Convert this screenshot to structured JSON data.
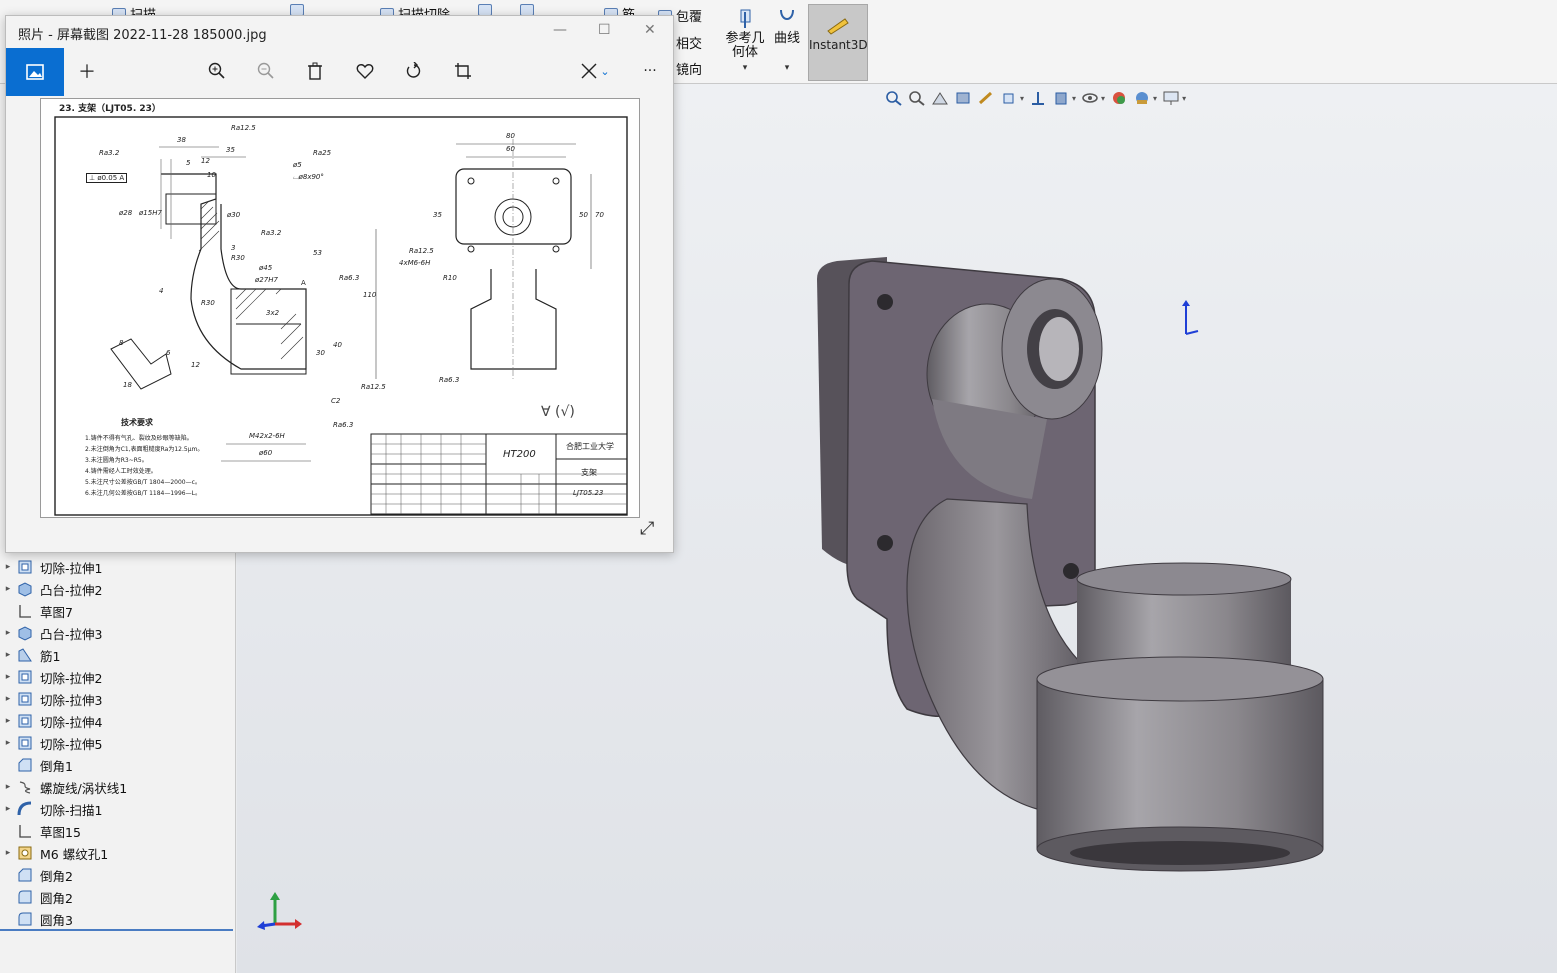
{
  "ribbon": {
    "sweep": "扫描",
    "sweep_cut": "扫描切除",
    "wrap": "包覆",
    "intersect": "相交",
    "mirror": "镜向",
    "ref_geometry_l1": "参考几",
    "ref_geometry_l2": "何体",
    "curves": "曲线",
    "instant3d": "Instant3D",
    "rib": "筋"
  },
  "photo_viewer": {
    "title": "照片 - 屏幕截图 2022-11-28 185000.jpg",
    "minimize": "—",
    "maximize": "☐",
    "close": "✕",
    "more": "···"
  },
  "drawing": {
    "heading": "23. 支架（LJT05. 23）",
    "material": "HT200",
    "school": "合肥工业大学",
    "part_name": "支架",
    "drawing_no": "LJT05.23",
    "tech_title": "技术要求",
    "tech_reqs": [
      "1.铸件不得有气孔、裂纹及砂眼等缺陷。",
      "2.未注倒角为C1,表面粗糙度Ra为12.5μm。",
      "3.未注圆角为R3~R5。",
      "4.铸件需经人工时效处理。",
      "5.未注尺寸公差按GB/T 1804—2000—c。",
      "6.未注几何公差按GB/T 1184—1996—L。"
    ],
    "dims": {
      "d38": "38",
      "d35": "35",
      "d5": "5",
      "d12": "12",
      "d10": "10",
      "ra125a": "Ra12.5",
      "ra32a": "Ra3.2",
      "ra25": "Ra25",
      "phi5": "ø5",
      "phi8": "⌴ø8x90°",
      "tol": "⊥ ø0.05 A",
      "phi28": "ø28",
      "phi15h7": "ø15H7",
      "phi30": "ø30",
      "r30": "R30",
      "r30b": "R30",
      "phi45": "ø45",
      "phi27h7": "ø27H7",
      "ra63a": "Ra6.3",
      "d53": "53",
      "d110": "110",
      "d40": "40",
      "d30": "30",
      "c2": "C2",
      "ra125b": "Ra12.5",
      "m42": "M42x2-6H",
      "phi60": "ø60",
      "ra63b": "Ra6.3",
      "d80": "80",
      "d60": "60",
      "d35b": "35",
      "d50": "50",
      "d70": "70",
      "ra125c": "Ra12.5",
      "m6": "4xM6-6H",
      "r10": "R10",
      "ra63c": "Ra6.3",
      "d8": "8",
      "d6": "6",
      "d18": "18",
      "d3": "3",
      "d4": "4",
      "d12b": "12",
      "d3x2": "3x2",
      "ra32b": "Ra3.2",
      "ra_sym": "∀ (√)",
      "a": "A"
    }
  },
  "tree": [
    {
      "label": "切除-拉伸1",
      "icon": "cut-extrude-icon",
      "arrow": true
    },
    {
      "label": "凸台-拉伸2",
      "icon": "boss-extrude-icon",
      "arrow": true
    },
    {
      "label": "草图7",
      "icon": "sketch-icon",
      "arrow": false
    },
    {
      "label": "凸台-拉伸3",
      "icon": "boss-extrude-icon",
      "arrow": true
    },
    {
      "label": "筋1",
      "icon": "rib-icon",
      "arrow": true
    },
    {
      "label": "切除-拉伸2",
      "icon": "cut-extrude-icon",
      "arrow": true
    },
    {
      "label": "切除-拉伸3",
      "icon": "cut-extrude-icon",
      "arrow": true
    },
    {
      "label": "切除-拉伸4",
      "icon": "cut-extrude-icon",
      "arrow": true
    },
    {
      "label": "切除-拉伸5",
      "icon": "cut-extrude-icon",
      "arrow": true
    },
    {
      "label": "倒角1",
      "icon": "chamfer-icon",
      "arrow": false
    },
    {
      "label": "螺旋线/涡状线1",
      "icon": "helix-icon",
      "arrow": true
    },
    {
      "label": "切除-扫描1",
      "icon": "cut-sweep-icon",
      "arrow": true
    },
    {
      "label": "草图15",
      "icon": "sketch-icon",
      "arrow": false
    },
    {
      "label": "M6 螺纹孔1",
      "icon": "hole-wizard-icon",
      "arrow": true
    },
    {
      "label": "倒角2",
      "icon": "chamfer-icon",
      "arrow": false
    },
    {
      "label": "圆角2",
      "icon": "fillet-icon",
      "arrow": false
    },
    {
      "label": "圆角3",
      "icon": "fillet-icon",
      "arrow": false
    }
  ],
  "colors": {
    "accent": "#0a6ed1",
    "model_face": "#6c6470",
    "model_metal": "#8e8b90"
  }
}
